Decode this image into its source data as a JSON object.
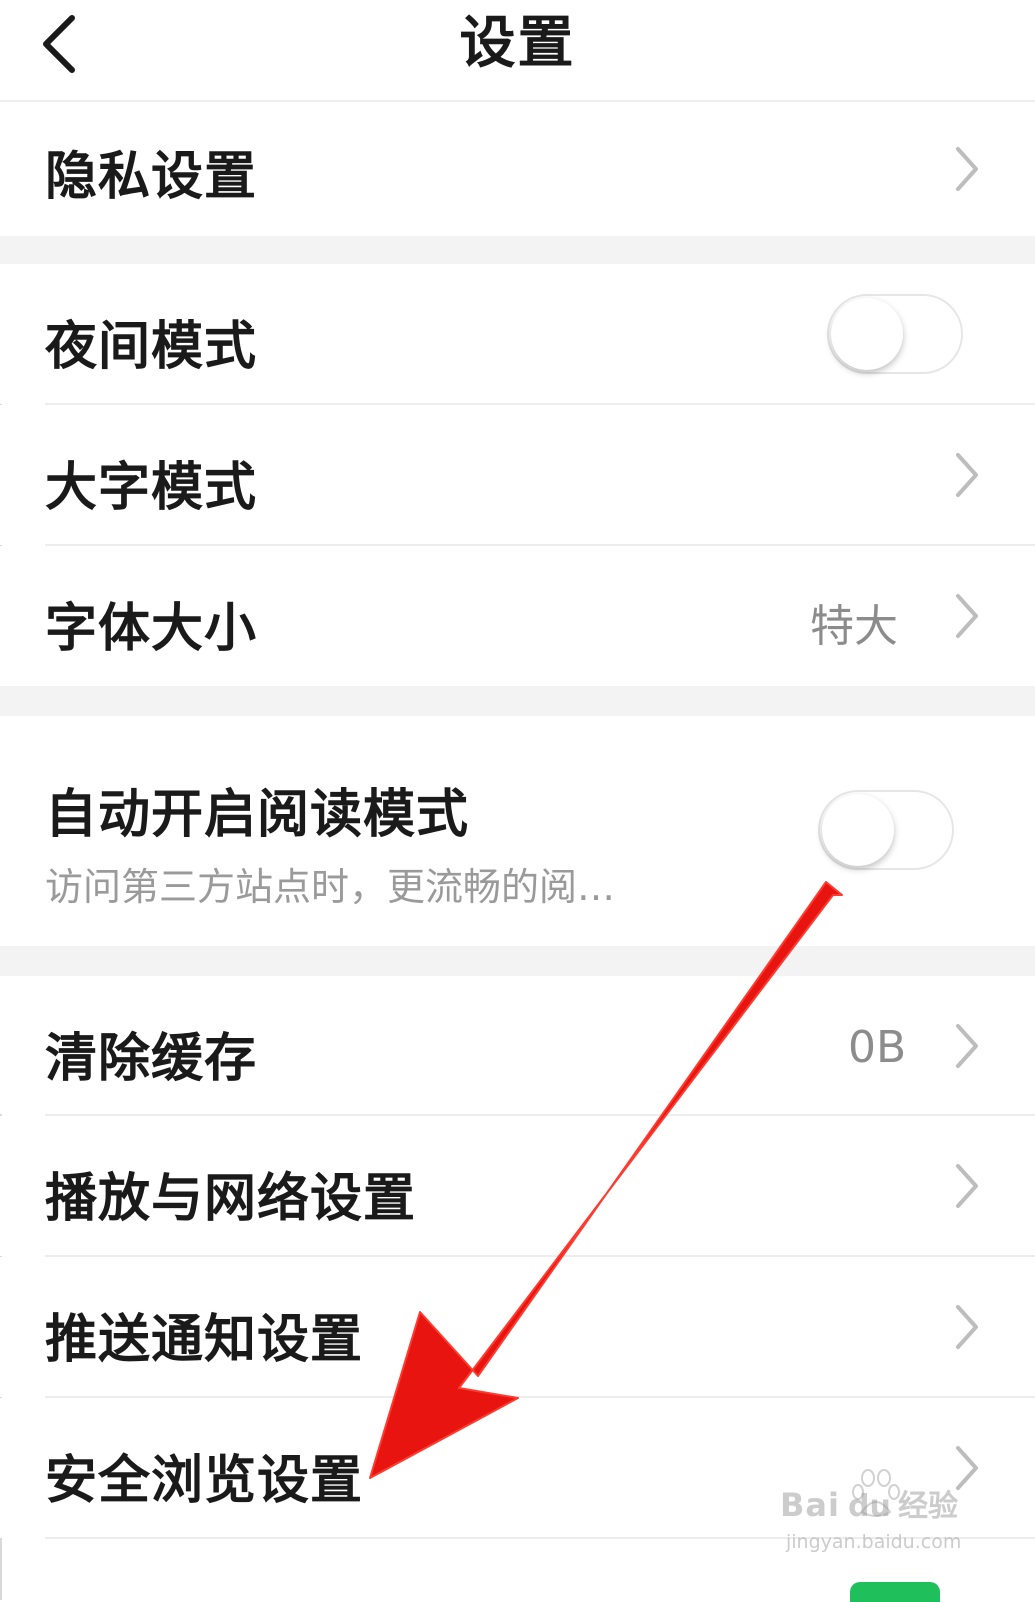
{
  "header": {
    "title": "设置",
    "back_icon": "chevron-left-icon"
  },
  "groups": [
    {
      "items": [
        {
          "label": "隐私设置",
          "control": "chevron"
        }
      ]
    },
    {
      "items": [
        {
          "label": "夜间模式",
          "control": "toggle",
          "toggle_on": false
        },
        {
          "label": "大字模式",
          "control": "chevron"
        },
        {
          "label": "字体大小",
          "value": "特大",
          "control": "chevron"
        }
      ]
    },
    {
      "items": [
        {
          "label": "自动开启阅读模式",
          "sublabel": "访问第三方站点时，更流畅的阅…",
          "control": "toggle",
          "toggle_on": false
        }
      ]
    },
    {
      "items": [
        {
          "label": "清除缓存",
          "value": "0B",
          "control": "chevron"
        },
        {
          "label": "播放与网络设置",
          "control": "chevron"
        },
        {
          "label": "推送通知设置",
          "control": "chevron"
        },
        {
          "label": "安全浏览设置",
          "control": "chevron"
        }
      ]
    }
  ],
  "annotation": {
    "type": "arrow",
    "color": "#e8140f",
    "points_to": "安全浏览设置"
  },
  "watermark": {
    "brand": "Bai du 经验",
    "url": "jingyan.baidu.com"
  },
  "colors": {
    "gap_background": "#f3f3f3",
    "divider": "#ededed",
    "value_text": "#8c8c8c",
    "peek_green": "#1fc05b"
  }
}
